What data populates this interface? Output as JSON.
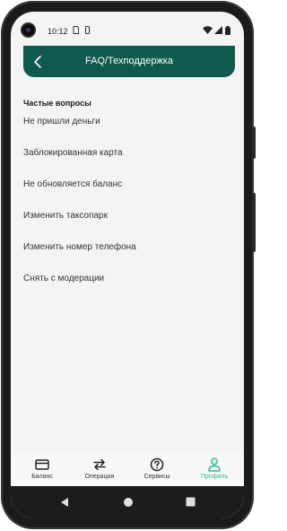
{
  "status_bar": {
    "time": "10:12",
    "icons": [
      "sim-icon",
      "vibrate-icon",
      "wifi-icon",
      "signal-icon",
      "battery-icon"
    ]
  },
  "header": {
    "title": "FAQ/Техподдержка",
    "back_icon": "chevron-left-icon",
    "color": "#0e5a4e"
  },
  "faq": {
    "title": "Частые вопросы",
    "items": [
      "Не пришли деньги",
      "Заблокированная карта",
      "Не обновляется баланс",
      "Изменить таксопарк",
      "Изменить номер телефона",
      "Снять с модерации"
    ]
  },
  "bottom_nav": {
    "items": [
      {
        "label": "Баланс",
        "icon": "card-icon",
        "active": false
      },
      {
        "label": "Операции",
        "icon": "swap-arrows-icon",
        "active": false
      },
      {
        "label": "Сервисы",
        "icon": "help-circle-icon",
        "active": false
      },
      {
        "label": "Профиль",
        "icon": "person-icon",
        "active": true
      }
    ],
    "active_color": "#2ebc95"
  },
  "system_nav": {
    "buttons": [
      "back-triangle-icon",
      "home-circle-icon",
      "recents-square-icon"
    ]
  }
}
